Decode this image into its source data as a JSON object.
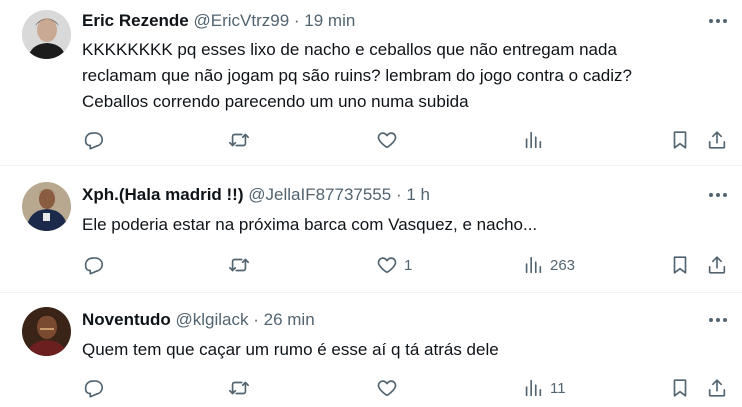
{
  "tweets": [
    {
      "name": "Eric Rezende",
      "handle": "@EricVtrz99",
      "time": "19 min",
      "text_lines": [
        "KKKKKKKK pq esses lixo de nacho e ceballos que não entregam nada",
        "reclamam que não jogam pq são ruins? lembram do jogo contra o cadiz?",
        "Ceballos correndo parecendo um uno numa subida"
      ],
      "likes": "",
      "views": ""
    },
    {
      "name": "Xph.(Hala madrid !!)",
      "handle": "@JellaIF87737555",
      "time": "1 h",
      "text_lines": [
        "Ele poderia estar na próxima barca com Vasquez, e nacho..."
      ],
      "likes": "1",
      "views": "263"
    },
    {
      "name": "Noventudo",
      "handle": "@klgilack",
      "time": "26 min",
      "text_lines": [
        "Quem tem que caçar um rumo é esse aí q tá atrás dele"
      ],
      "likes": "",
      "views": "11"
    }
  ],
  "icons": {
    "reply": "reply-icon",
    "retweet": "retweet-icon",
    "like": "heart-icon",
    "views": "views-icon",
    "bookmark": "bookmark-icon",
    "share": "share-icon",
    "more": "more-icon"
  },
  "colors": {
    "text": "#0f1419",
    "secondary": "#536471",
    "divider": "#eff3f4"
  }
}
